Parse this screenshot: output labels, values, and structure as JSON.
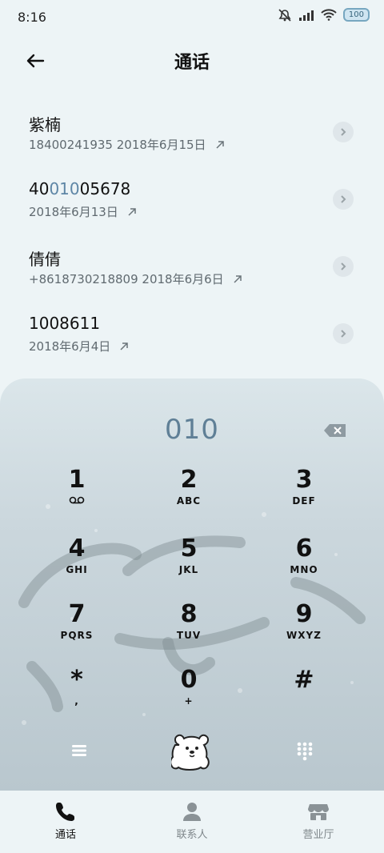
{
  "status": {
    "time": "8:16",
    "battery": "100"
  },
  "header": {
    "title": "通话"
  },
  "calls": [
    {
      "name": "紫楠",
      "detail": "18400241935  2018年6月15日"
    },
    {
      "name_parts": [
        "40",
        "010",
        "05678"
      ],
      "detail": "2018年6月13日"
    },
    {
      "name": "倩倩",
      "detail": "+8618730218809  2018年6月6日"
    },
    {
      "name": "1008611",
      "detail": "2018年6月4日"
    }
  ],
  "dialer": {
    "number": "010",
    "keys": [
      {
        "digit": "1",
        "letters": ""
      },
      {
        "digit": "2",
        "letters": "ABC"
      },
      {
        "digit": "3",
        "letters": "DEF"
      },
      {
        "digit": "4",
        "letters": "GHI"
      },
      {
        "digit": "5",
        "letters": "JKL"
      },
      {
        "digit": "6",
        "letters": "MNO"
      },
      {
        "digit": "7",
        "letters": "PQRS"
      },
      {
        "digit": "8",
        "letters": "TUV"
      },
      {
        "digit": "9",
        "letters": "WXYZ"
      },
      {
        "digit": "*",
        "letters": ","
      },
      {
        "digit": "0",
        "letters": "+"
      },
      {
        "digit": "#",
        "letters": ""
      }
    ]
  },
  "nav": {
    "tabs": [
      {
        "label": "通话",
        "icon": "phone-icon",
        "active": true
      },
      {
        "label": "联系人",
        "icon": "person-icon",
        "active": false
      },
      {
        "label": "营业厅",
        "icon": "store-icon",
        "active": false
      }
    ]
  },
  "colors": {
    "background": "#edf4f6",
    "dial_number": "#5f7f96",
    "highlight": "#5e86a6",
    "tab_active": "#111111",
    "tab_inactive": "#7f878b"
  }
}
